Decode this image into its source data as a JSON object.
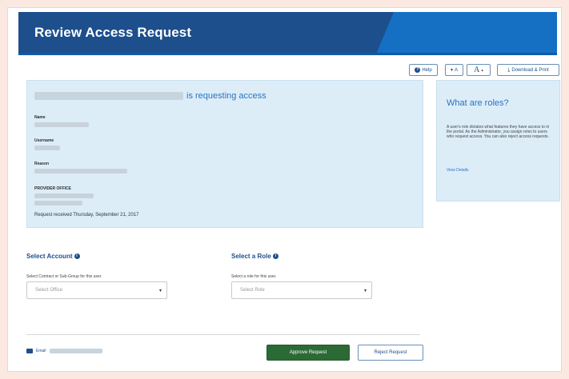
{
  "header": {
    "title": "Review Access Request"
  },
  "toolbar": {
    "help_label": "Help",
    "font_smaller_label": "A",
    "font_larger_label": "A",
    "download_label": "Download & Print"
  },
  "request": {
    "heading_suffix": "is requesting access",
    "name_label": "Name",
    "username_label": "Username",
    "reason_label": "Reason",
    "office_label": "PROVIDER OFFICE",
    "received_text": "Request received Thursday, September 21, 2017"
  },
  "roles_info": {
    "title": "What are roles?",
    "body": "A user's role dictates what features they have access to in the portal. As the Administrator, you assign roles to users who request access. You can also reject access requests.",
    "link_label": "View Details"
  },
  "account": {
    "title": "Select Account",
    "hint": "Select Contract or Sub-Group for this user.",
    "placeholder": "Select Office"
  },
  "role": {
    "title": "Select a Role",
    "hint": "Select a role for this user.",
    "placeholder": "Select Role"
  },
  "footer": {
    "email_label": "Email",
    "approve_label": "Approve Request",
    "reject_label": "Reject Request"
  },
  "colors": {
    "header_dark": "#1d4f8c",
    "header_light": "#1570c4",
    "panel_bg": "#dcedf8",
    "approve_green": "#2c6a35"
  }
}
